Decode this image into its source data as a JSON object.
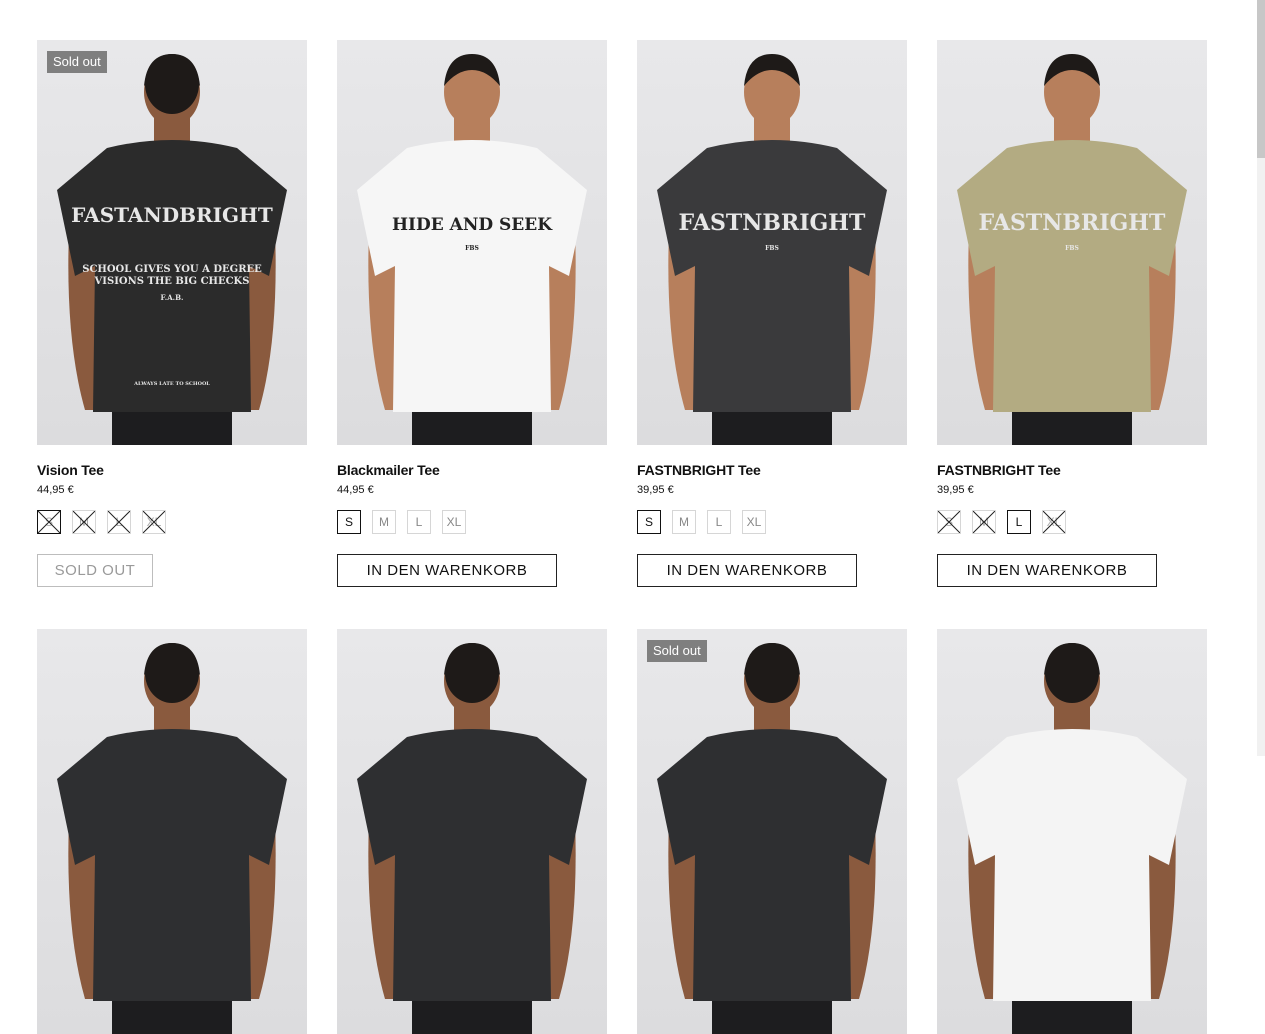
{
  "products": [
    {
      "name": "Vision Tee",
      "price": "44,95 €",
      "badge": "Sold out",
      "button": "SOLD OUT",
      "button_state": "soldout",
      "sizes": [
        {
          "label": "S",
          "state": "sold-selected"
        },
        {
          "label": "M",
          "state": "sold"
        },
        {
          "label": "L",
          "state": "sold"
        },
        {
          "label": "XL",
          "state": "sold"
        }
      ],
      "shirt_color": "#2b2b2b",
      "view": "back",
      "print_lines": [
        "FASTANDBRIGHT",
        "SCHOOL GIVES YOU A DEGREE",
        "VISIONS THE BIG CHECKS",
        "F.A.B.",
        "ALWAYS LATE TO SCHOOL"
      ]
    },
    {
      "name": "Blackmailer Tee",
      "price": "44,95 €",
      "badge": "",
      "button": "IN DEN WARENKORB",
      "button_state": "active",
      "sizes": [
        {
          "label": "S",
          "state": "selected"
        },
        {
          "label": "M",
          "state": "available"
        },
        {
          "label": "L",
          "state": "available"
        },
        {
          "label": "XL",
          "state": "available"
        }
      ],
      "shirt_color": "#f6f6f6",
      "view": "front",
      "print_lines": [
        "HIDE AND SEEK",
        "FBS"
      ]
    },
    {
      "name": "FASTNBRIGHT Tee",
      "price": "39,95 €",
      "badge": "",
      "button": "IN DEN WARENKORB",
      "button_state": "active",
      "sizes": [
        {
          "label": "S",
          "state": "selected"
        },
        {
          "label": "M",
          "state": "available"
        },
        {
          "label": "L",
          "state": "available"
        },
        {
          "label": "XL",
          "state": "available"
        }
      ],
      "shirt_color": "#3a3a3c",
      "view": "front",
      "print_lines": [
        "FASTNBRIGHT",
        "FBS"
      ]
    },
    {
      "name": "FASTNBRIGHT Tee",
      "price": "39,95 €",
      "badge": "",
      "button": "IN DEN WARENKORB",
      "button_state": "active",
      "sizes": [
        {
          "label": "S",
          "state": "sold"
        },
        {
          "label": "M",
          "state": "sold"
        },
        {
          "label": "L",
          "state": "selected"
        },
        {
          "label": "XL",
          "state": "sold"
        }
      ],
      "shirt_color": "#b3ab82",
      "view": "front",
      "print_lines": [
        "FASTNBRIGHT",
        "FBS"
      ]
    }
  ],
  "second_row": [
    {
      "badge": "",
      "shirt_color": "#2e2f31",
      "view": "back"
    },
    {
      "badge": "",
      "shirt_color": "#2e2f31",
      "view": "back"
    },
    {
      "badge": "Sold out",
      "shirt_color": "#2e2f31",
      "view": "back"
    },
    {
      "badge": "",
      "shirt_color": "#f4f4f4",
      "view": "back"
    }
  ],
  "colors": {
    "badge_bg": "#7f7f7f",
    "skin": "#8a5a3e",
    "skin_light": "#b77f5c",
    "hair": "#1e1a18"
  }
}
